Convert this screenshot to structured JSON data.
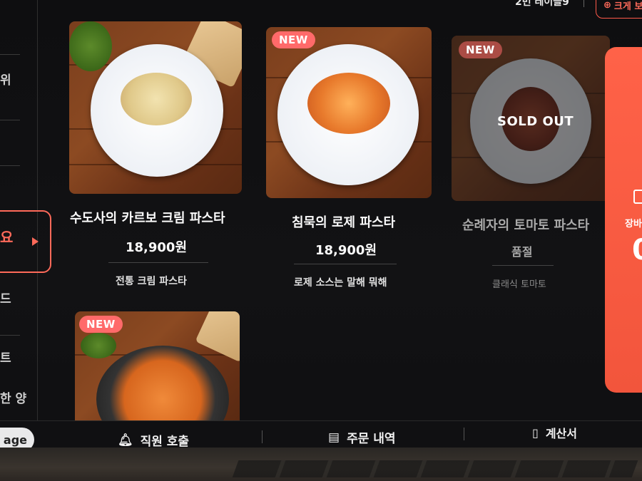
{
  "header": {
    "table_label": "2번 테이블9",
    "zoom_label": "크게 보"
  },
  "sidebar": {
    "items": [
      "위",
      "요",
      "드",
      "트",
      "한 양"
    ],
    "active_index": 1
  },
  "menu": [
    {
      "name": "수도사의 카르보 크림 파스타",
      "price": "18,900원",
      "desc": "전통 크림 파스타",
      "badge": "",
      "sold_out": false
    },
    {
      "name": "침묵의 로제 파스타",
      "price": "18,900원",
      "desc": "로제 소스는 말해 뭐해",
      "badge": "NEW",
      "sold_out": false
    },
    {
      "name": "순례자의 토마토 파스타",
      "price": "품절",
      "desc": "클래식 토마토",
      "badge": "NEW",
      "sold_out": true,
      "sold_out_label": "SOLD OUT"
    },
    {
      "name": "",
      "price": "",
      "desc": "",
      "badge": "NEW",
      "sold_out": false
    }
  ],
  "cart": {
    "label": "장바",
    "count": "0"
  },
  "bottom": {
    "lang_label": "age",
    "call_staff": "직원 호출",
    "order_history": "주문 내역",
    "bill": "계산서"
  },
  "colors": {
    "accent": "#ff6a5a",
    "badge": "#ff6a6a",
    "cart": "#f2553c",
    "background": "#0e0e10"
  }
}
